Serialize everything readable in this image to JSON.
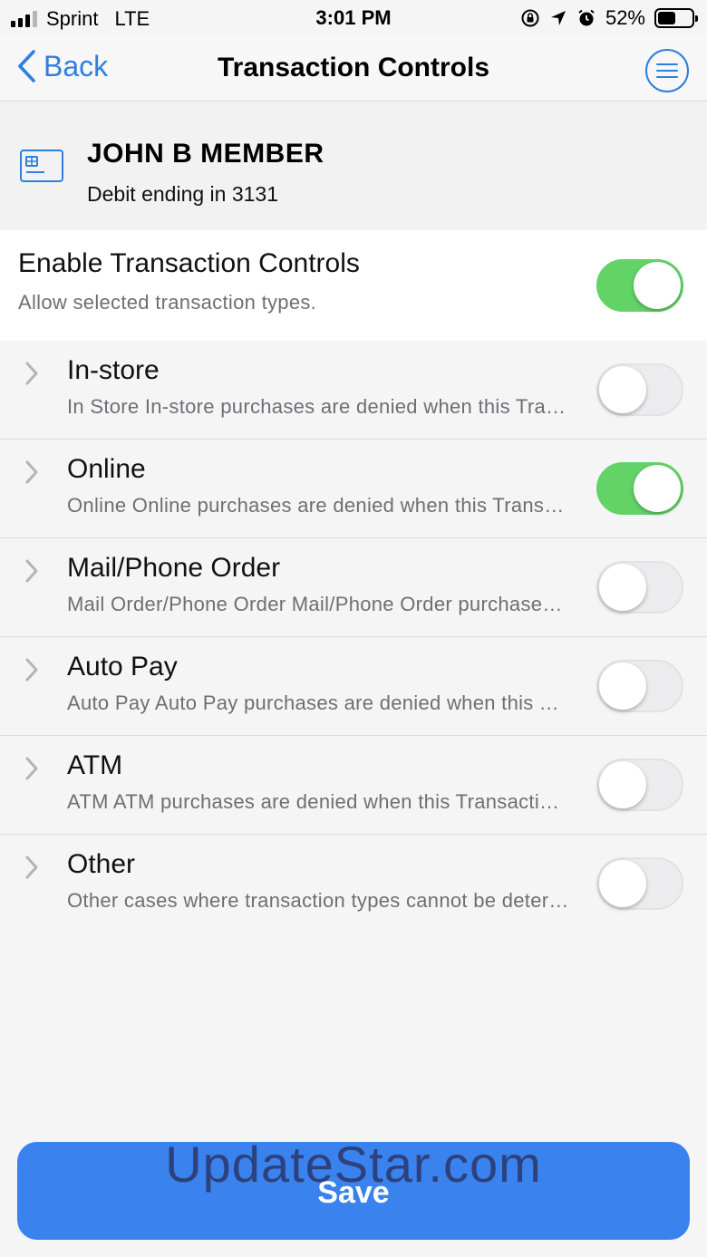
{
  "status_bar": {
    "carrier": "Sprint",
    "network": "LTE",
    "time": "3:01 PM",
    "battery": "52%",
    "battery_level": 0.52,
    "icons": [
      "signal-icon",
      "orientation-lock-icon",
      "location-icon",
      "alarm-icon",
      "battery-icon"
    ]
  },
  "nav": {
    "back_label": "Back",
    "title": "Transaction Controls",
    "menu_icon": "hamburger-menu-icon"
  },
  "card": {
    "icon": "credit-card-icon",
    "name": "JOHN B MEMBER",
    "description": "Debit ending in 3131"
  },
  "enable": {
    "title": "Enable Transaction Controls",
    "subtitle": "Allow selected transaction types.",
    "on": true
  },
  "controls": [
    {
      "title": "In-store",
      "description": "In Store In-store purchases are denied when this Transaction Control is enabled",
      "on": false
    },
    {
      "title": "Online",
      "description": "Online Online purchases are denied when this Transaction Control is enabled",
      "on": true
    },
    {
      "title": "Mail/Phone Order",
      "description": "Mail Order/Phone Order Mail/Phone Order purchases are denied when this Transaction Control is enabled",
      "on": false
    },
    {
      "title": "Auto Pay",
      "description": "Auto Pay Auto Pay purchases are denied when this Transaction Control is enabled",
      "on": false
    },
    {
      "title": "ATM",
      "description": "ATM ATM purchases are denied when this Transaction Control is enabled",
      "on": false
    },
    {
      "title": "Other",
      "description": "Other cases where transaction types cannot be determined",
      "on": false
    }
  ],
  "save_label": "Save",
  "watermark": "UpdateStar.com",
  "colors": {
    "accent": "#2f7ee0",
    "toggle_on": "#63d368",
    "save_button": "#3a82ee"
  }
}
